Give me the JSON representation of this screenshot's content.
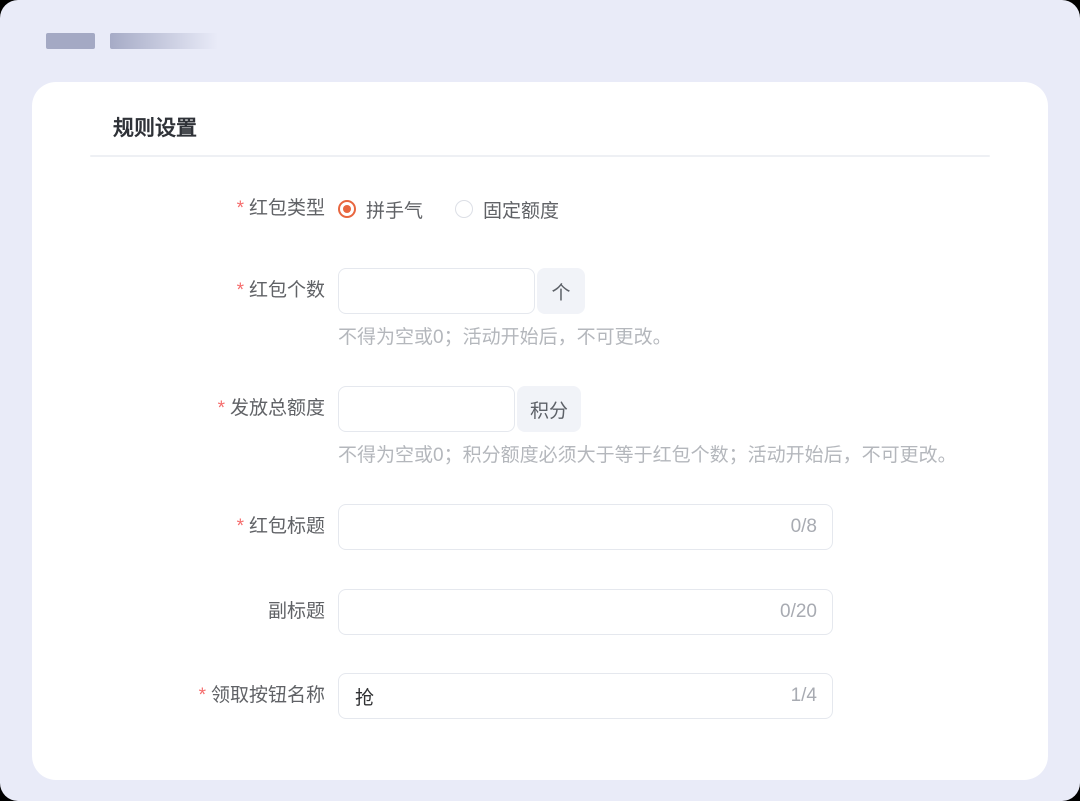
{
  "colors": {
    "page_background": "#e9ebf8",
    "card_background": "#ffffff",
    "radio_selected": "#e8663f",
    "required_asterisk": "#f56c6c",
    "skeleton_bar": "#a4a9c4"
  },
  "card": {
    "title": "规则设置"
  },
  "form": {
    "required_marker": "*",
    "packet_type": {
      "label": "红包类型",
      "required": true,
      "options": [
        {
          "label": "拼手气",
          "selected": true
        },
        {
          "label": "固定额度",
          "selected": false
        }
      ]
    },
    "packet_count": {
      "label": "红包个数",
      "required": true,
      "value": "",
      "unit": "个",
      "help": "不得为空或0；活动开始后，不可更改。"
    },
    "total_amount": {
      "label": "发放总额度",
      "required": true,
      "value": "",
      "unit": "积分",
      "help": "不得为空或0；积分额度必须大于等于红包个数；活动开始后，不可更改。"
    },
    "packet_title": {
      "label": "红包标题",
      "required": true,
      "value": "",
      "counter": "0/8"
    },
    "subtitle": {
      "label": "副标题",
      "required": false,
      "value": "",
      "counter": "0/20"
    },
    "claim_button_name": {
      "label": "领取按钮名称",
      "required": true,
      "value": "抢",
      "counter": "1/4"
    }
  }
}
